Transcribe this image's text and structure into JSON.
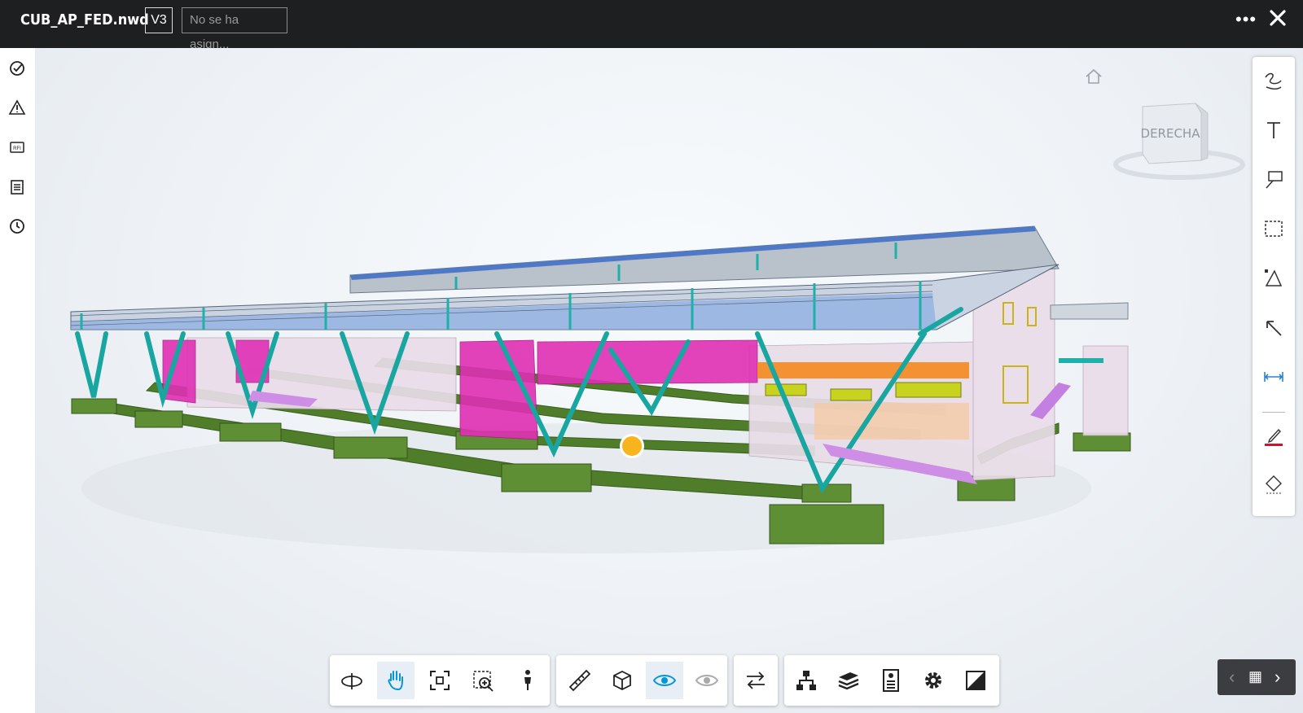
{
  "header": {
    "file_name": "CUB_AP_FED.nwd",
    "version": "V3",
    "assign_placeholder": "No se ha asign..."
  },
  "left_toolbar": {
    "items": [
      "check-circle-icon",
      "issues-warning-icon",
      "rfi-icon",
      "sheets-list-icon",
      "history-clock-icon"
    ],
    "rfi_label": "RFI"
  },
  "viewcube": {
    "face_label": "DERECHA"
  },
  "markup_toolbar": {
    "tools": [
      "freehand-icon",
      "text-icon",
      "callout-icon",
      "cloud-icon",
      "polygon-icon",
      "arrow-icon",
      "dimension-icon",
      "pen-color-icon",
      "fill-icon"
    ],
    "pen_color": "#d4112b"
  },
  "bottom_toolbar": {
    "group1": [
      "orbit-icon",
      "pan-icon",
      "fit-view-icon",
      "zoom-window-icon",
      "walk-icon"
    ],
    "group2": [
      "measure-icon",
      "section-box-icon",
      "visibility-icon",
      "hidden-objects-icon"
    ],
    "group3": [
      "compare-icon"
    ],
    "group4": [
      "model-browser-icon",
      "layers-icon",
      "properties-icon",
      "settings-icon",
      "fullscreen-icon"
    ],
    "active": "pan-icon"
  },
  "colors": {
    "accent": "#0696d7",
    "toolbar_bg": "#1e1f21"
  }
}
